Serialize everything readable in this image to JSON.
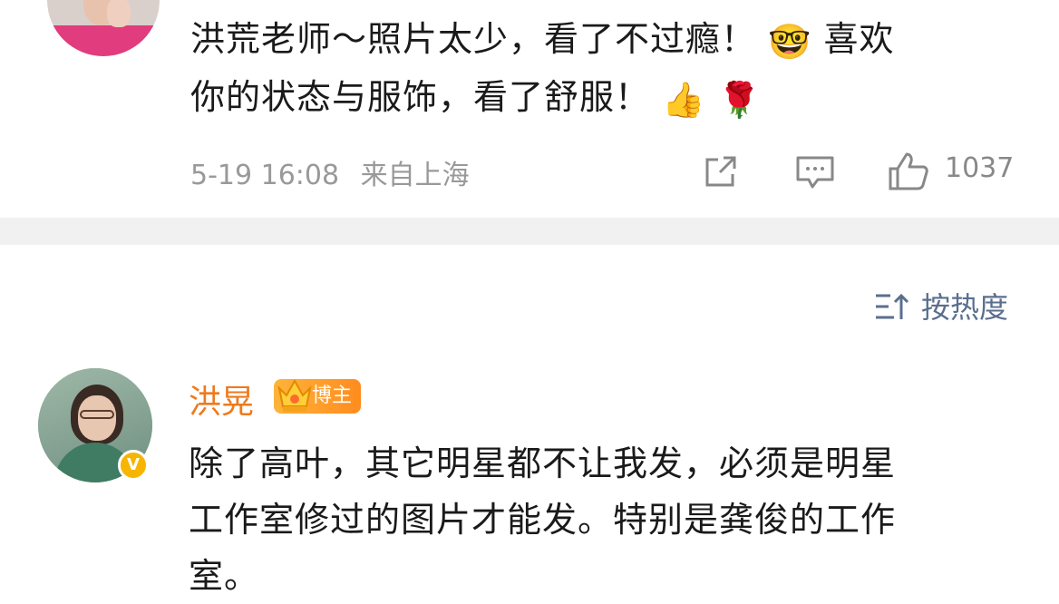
{
  "comment_previous": {
    "text_line1": "洪荒老师～照片太少，看了不过瘾！",
    "emoji_nerd": "🤓",
    "text_line1_end": "喜欢",
    "text_line2": "你的状态与服饰，看了舒服！",
    "emoji_thumb": "👍",
    "emoji_rose": "🌹",
    "timestamp": "5-19 16:08",
    "location": "来自上海",
    "like_count": "1037"
  },
  "sort": {
    "label": "按热度"
  },
  "comment_main": {
    "username": "洪晃",
    "badge_label": "博主",
    "verified_mark": "V",
    "text_line1": "除了高叶，其它明星都不让我发，必须是明星",
    "text_line2": "工作室修过的图片才能发。特别是龚俊的工作",
    "text_line3": "室。"
  },
  "colors": {
    "username": "#ee7a1e",
    "meta": "#999999",
    "sort": "#5a6f8e",
    "divider": "#f1f1f1",
    "verified": "#f7b500"
  },
  "icons": [
    "share-icon",
    "reply-icon",
    "like-icon",
    "sort-icon",
    "crown-icon"
  ]
}
